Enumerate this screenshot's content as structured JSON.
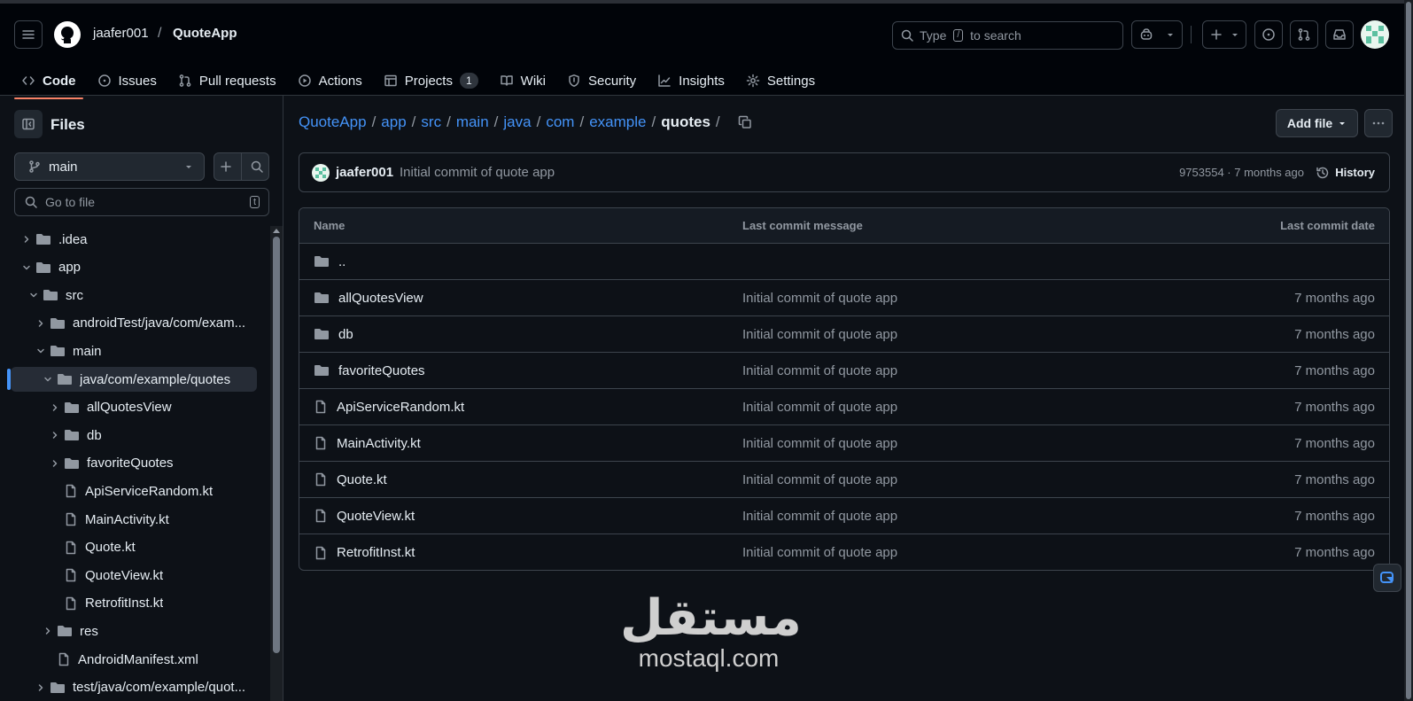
{
  "header": {
    "owner": "jaafer001",
    "separator": "/",
    "repo": "QuoteApp",
    "search_prefix": "Type",
    "search_key": "/",
    "search_suffix": "to search"
  },
  "tabs": [
    {
      "label": "Code",
      "icon": "code-icon",
      "active": true
    },
    {
      "label": "Issues",
      "icon": "issue-icon"
    },
    {
      "label": "Pull requests",
      "icon": "pull-request-icon"
    },
    {
      "label": "Actions",
      "icon": "play-icon"
    },
    {
      "label": "Projects",
      "icon": "table-icon",
      "count": "1"
    },
    {
      "label": "Wiki",
      "icon": "book-icon"
    },
    {
      "label": "Security",
      "icon": "shield-icon"
    },
    {
      "label": "Insights",
      "icon": "graph-icon"
    },
    {
      "label": "Settings",
      "icon": "gear-icon"
    }
  ],
  "sidebar": {
    "title": "Files",
    "branch": "main",
    "goto_placeholder": "Go to file",
    "goto_key": "t",
    "tree": [
      {
        "label": ".idea",
        "type": "folder",
        "level": 0,
        "expanded": false
      },
      {
        "label": "app",
        "type": "folder",
        "level": 0,
        "expanded": true
      },
      {
        "label": "src",
        "type": "folder",
        "level": 1,
        "expanded": true
      },
      {
        "label": "androidTest/java/com/exam...",
        "type": "folder",
        "level": 2,
        "expanded": false
      },
      {
        "label": "main",
        "type": "folder",
        "level": 2,
        "expanded": true
      },
      {
        "label": "java/com/example/quotes",
        "type": "folder",
        "level": 3,
        "expanded": true,
        "selected": true
      },
      {
        "label": "allQuotesView",
        "type": "folder",
        "level": 4,
        "expanded": false
      },
      {
        "label": "db",
        "type": "folder",
        "level": 4,
        "expanded": false
      },
      {
        "label": "favoriteQuotes",
        "type": "folder",
        "level": 4,
        "expanded": false
      },
      {
        "label": "ApiServiceRandom.kt",
        "type": "file",
        "level": 4
      },
      {
        "label": "MainActivity.kt",
        "type": "file",
        "level": 4
      },
      {
        "label": "Quote.kt",
        "type": "file",
        "level": 4
      },
      {
        "label": "QuoteView.kt",
        "type": "file",
        "level": 4
      },
      {
        "label": "RetrofitInst.kt",
        "type": "file",
        "level": 4
      },
      {
        "label": "res",
        "type": "folder",
        "level": 3,
        "expanded": false
      },
      {
        "label": "AndroidManifest.xml",
        "type": "file",
        "level": 3
      },
      {
        "label": "test/java/com/example/quot...",
        "type": "folder",
        "level": 2,
        "expanded": false
      }
    ]
  },
  "breadcrumb": {
    "parts": [
      "QuoteApp",
      "app",
      "src",
      "main",
      "java",
      "com",
      "example"
    ],
    "current": "quotes",
    "separator": "/"
  },
  "add_file_label": "Add file",
  "commit": {
    "author": "jaafer001",
    "message": "Initial commit of quote app",
    "sha_time": "9753554 · 7 months ago",
    "history_label": "History"
  },
  "table": {
    "headers": {
      "name": "Name",
      "message": "Last commit message",
      "date": "Last commit date"
    },
    "parent": "..",
    "rows": [
      {
        "name": "allQuotesView",
        "type": "folder",
        "message": "Initial commit of quote app",
        "date": "7 months ago"
      },
      {
        "name": "db",
        "type": "folder",
        "message": "Initial commit of quote app",
        "date": "7 months ago"
      },
      {
        "name": "favoriteQuotes",
        "type": "folder",
        "message": "Initial commit of quote app",
        "date": "7 months ago"
      },
      {
        "name": "ApiServiceRandom.kt",
        "type": "file",
        "message": "Initial commit of quote app",
        "date": "7 months ago"
      },
      {
        "name": "MainActivity.kt",
        "type": "file",
        "message": "Initial commit of quote app",
        "date": "7 months ago"
      },
      {
        "name": "Quote.kt",
        "type": "file",
        "message": "Initial commit of quote app",
        "date": "7 months ago"
      },
      {
        "name": "QuoteView.kt",
        "type": "file",
        "message": "Initial commit of quote app",
        "date": "7 months ago"
      },
      {
        "name": "RetrofitInst.kt",
        "type": "file",
        "message": "Initial commit of quote app",
        "date": "7 months ago"
      }
    ]
  },
  "watermark": {
    "arabic": "مستقل",
    "latin": "mostaql.com"
  },
  "colors": {
    "accent_link": "#4493f8",
    "tab_underline": "#f78166",
    "selected_marker": "#4493f8"
  }
}
